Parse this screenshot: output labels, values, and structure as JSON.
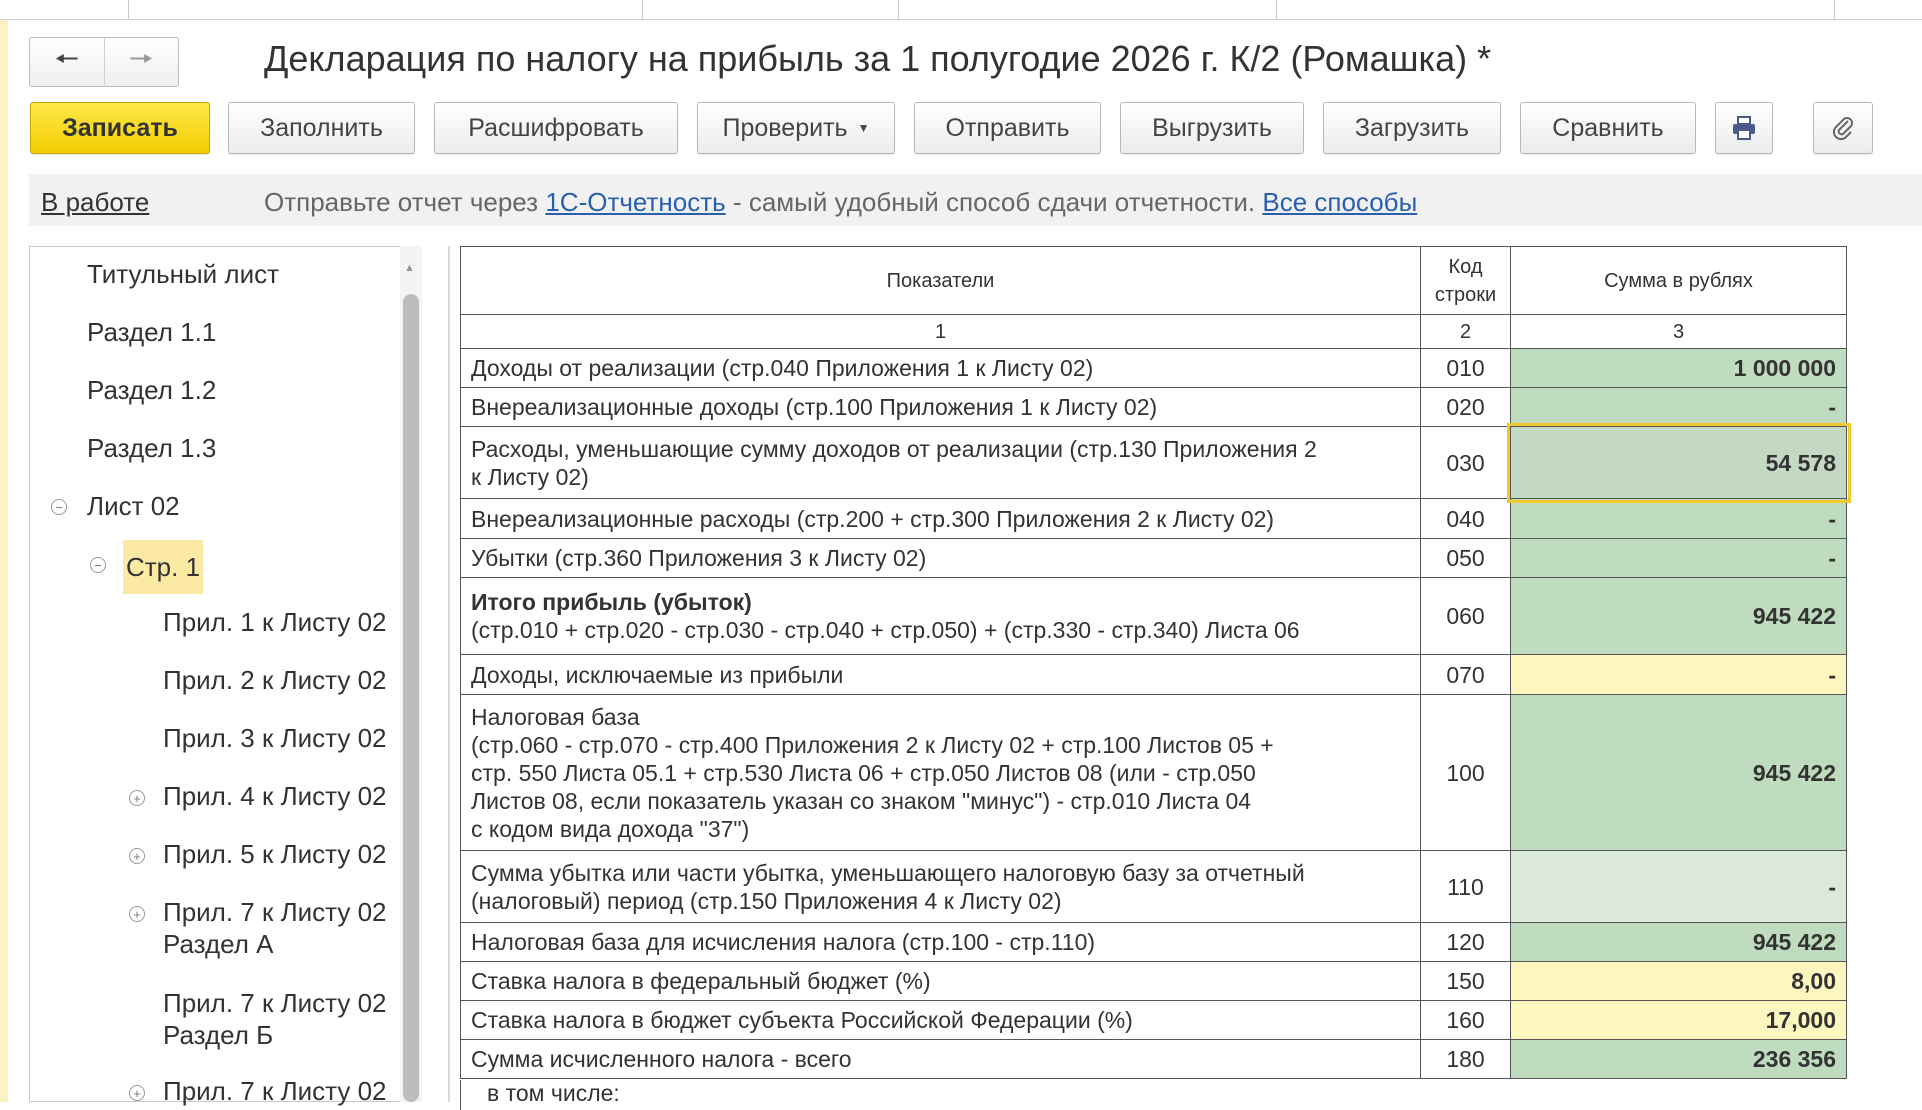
{
  "window": {
    "title": "Декларация по налогу на прибыль за 1 полугодие 2026 г. К/2 (Ромашка) *"
  },
  "toolbar": {
    "save": "Записать",
    "fill": "Заполнить",
    "decode": "Расшифровать",
    "check": "Проверить",
    "send": "Отправить",
    "export": "Выгрузить",
    "import": "Загрузить",
    "compare": "Сравнить"
  },
  "status": {
    "state": "В работе",
    "msg_before": "Отправьте отчет через",
    "link_service": "1С-Отчетность",
    "msg_after": "- самый удобный способ сдачи отчетности.",
    "link_all": "Все способы"
  },
  "tree": {
    "items": [
      {
        "label": "Титульный лист"
      },
      {
        "label": "Раздел 1.1"
      },
      {
        "label": "Раздел 1.2"
      },
      {
        "label": "Раздел 1.3"
      },
      {
        "label": "Лист 02"
      },
      {
        "label": "Стр. 1"
      },
      {
        "label": "Прил. 1 к Листу 02"
      },
      {
        "label": "Прил. 2 к Листу 02"
      },
      {
        "label": "Прил. 3 к Листу 02"
      },
      {
        "label": "Прил. 4 к Листу 02"
      },
      {
        "label": "Прил. 5 к Листу 02"
      },
      {
        "label": "Прил. 7 к Листу 02",
        "sub": "Раздел А"
      },
      {
        "label": "Прил. 7 к Листу 02",
        "sub": "Раздел Б"
      },
      {
        "label": "Прил. 7 к Листу 02"
      }
    ]
  },
  "table": {
    "header": {
      "indicators": "Показатели",
      "code_line1": "Код",
      "code_line2": "строки",
      "sum": "Сумма в рублях"
    },
    "colnums": [
      "1",
      "2",
      "3"
    ],
    "rows": [
      {
        "label": "Доходы от реализации (стр.040 Приложения 1 к Листу 02)",
        "code": "010",
        "value": "1 000 000"
      },
      {
        "label": "Внереализационные доходы (стр.100 Приложения 1 к Листу 02)",
        "code": "020",
        "value": "-"
      },
      {
        "label_line1": "Расходы, уменьшающие сумму доходов от реализации (стр.130 Приложения 2",
        "label_line2": "к Листу 02)",
        "code": "030",
        "value": "54 578"
      },
      {
        "label": "Внереализационные расходы (стр.200 + стр.300 Приложения 2 к Листу 02)",
        "code": "040",
        "value": "-"
      },
      {
        "label": "Убытки (стр.360 Приложения 3 к Листу 02)",
        "code": "050",
        "value": "-"
      },
      {
        "label_line1": "Итого прибыль (убыток)",
        "label_line2": "(стр.010 + стр.020 - стр.030 - стр.040 + стр.050) + (стр.330 - стр.340) Листа 06",
        "code": "060",
        "value": "945 422"
      },
      {
        "label": "Доходы, исключаемые из прибыли",
        "code": "070",
        "value": "-"
      },
      {
        "label_line1": "Налоговая база",
        "label_line2": "(стр.060 - стр.070 - стр.400 Приложения 2 к Листу 02 + стр.100 Листов 05 +",
        "label_line3": "стр. 550 Листа 05.1 + стр.530 Листа 06 + стр.050 Листов 08 (или - стр.050",
        "label_line4": "Листов 08, если показатель указан со знаком \"минус\") - стр.010 Листа 04",
        "label_line5": "с кодом вида дохода \"37\")",
        "code": "100",
        "value": "945 422"
      },
      {
        "label_line1": "Сумма убытка или части убытка, уменьшающего налоговую базу за отчетный",
        "label_line2": "(налоговый) период (стр.150 Приложения 4 к Листу 02)",
        "code": "110",
        "value": "-"
      },
      {
        "label": "Налоговая база для исчисления налога (стр.100 - стр.110)",
        "code": "120",
        "value": "945 422"
      },
      {
        "label": "Ставка налога в федеральный бюджет (%)",
        "code": "150",
        "value": "8,00"
      },
      {
        "label": "Ставка налога в бюджет субъекта Российской Федерации (%)",
        "code": "160",
        "value": "17,000"
      },
      {
        "label": "Сумма исчисленного налога - всего",
        "code": "180",
        "value": "236 356"
      }
    ],
    "continuation": "в том числе:"
  },
  "colors": {
    "primary_button": "#f7d600",
    "computed_cell": "#bfdcbf",
    "editable_cell": "#fdf7bf",
    "focus_outline": "#f2c92c",
    "link": "#2a5fb0"
  }
}
